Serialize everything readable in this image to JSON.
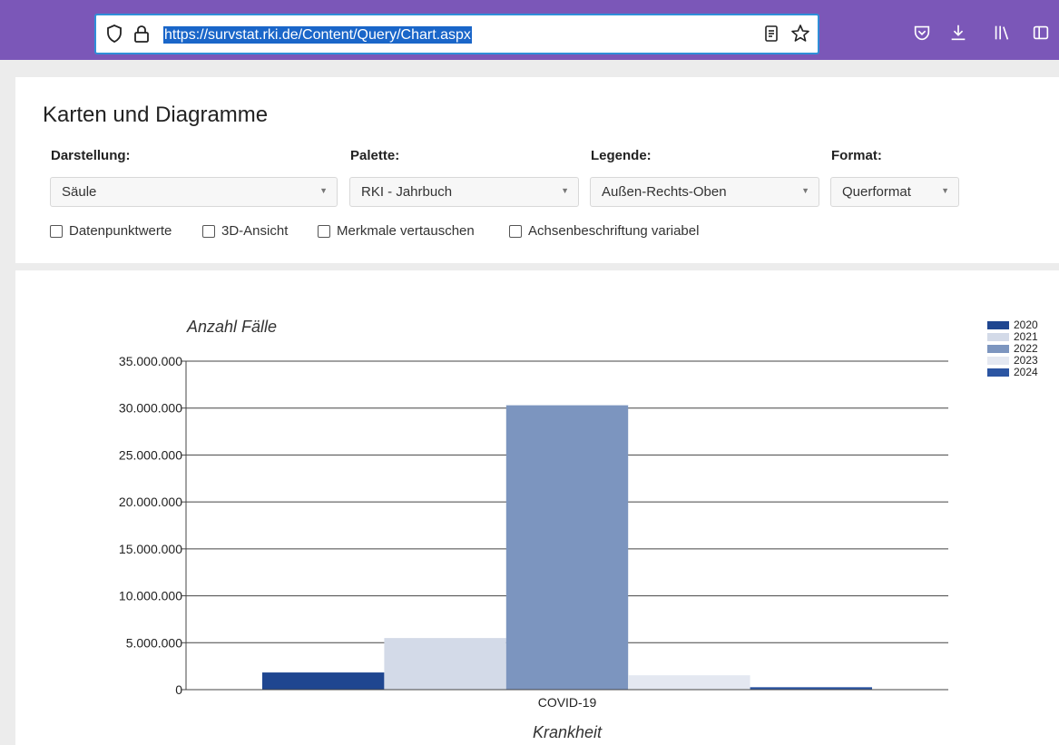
{
  "browser": {
    "url": "https://survstat.rki.de/Content/Query/Chart.aspx"
  },
  "page": {
    "title": "Karten und Diagramme"
  },
  "controls": {
    "darstellung": {
      "label": "Darstellung:",
      "value": "Säule"
    },
    "palette": {
      "label": "Palette:",
      "value": "RKI - Jahrbuch"
    },
    "legende": {
      "label": "Legende:",
      "value": "Außen-Rechts-Oben"
    },
    "format": {
      "label": "Format:",
      "value": "Querformat"
    }
  },
  "checkboxes": [
    {
      "label": "Datenpunktwerte",
      "checked": false
    },
    {
      "label": "3D-Ansicht",
      "checked": false
    },
    {
      "label": "Merkmale vertauschen",
      "checked": false
    },
    {
      "label": "Achsenbeschriftung variabel",
      "checked": false
    }
  ],
  "chart_data": {
    "type": "bar",
    "categories": [
      "COVID-19"
    ],
    "series": [
      {
        "name": "2020",
        "values": [
          1830000
        ],
        "color": "#1f4690"
      },
      {
        "name": "2021",
        "values": [
          5500000
        ],
        "color": "#d3dae8"
      },
      {
        "name": "2022",
        "values": [
          30300000
        ],
        "color": "#7c95bf"
      },
      {
        "name": "2023",
        "values": [
          1530000
        ],
        "color": "#e4e8f1"
      },
      {
        "name": "2024",
        "values": [
          260000
        ],
        "color": "#2c55a2"
      }
    ],
    "ylabel": "Anzahl Fälle",
    "xlabel": "Krankheit",
    "ylim": [
      0,
      35000000
    ],
    "yticks": [
      "0",
      "5.000.000",
      "10.000.000",
      "15.000.000",
      "20.000.000",
      "25.000.000",
      "30.000.000",
      "35.000.000"
    ],
    "grid": true,
    "legend_position": "outside-top-right"
  }
}
